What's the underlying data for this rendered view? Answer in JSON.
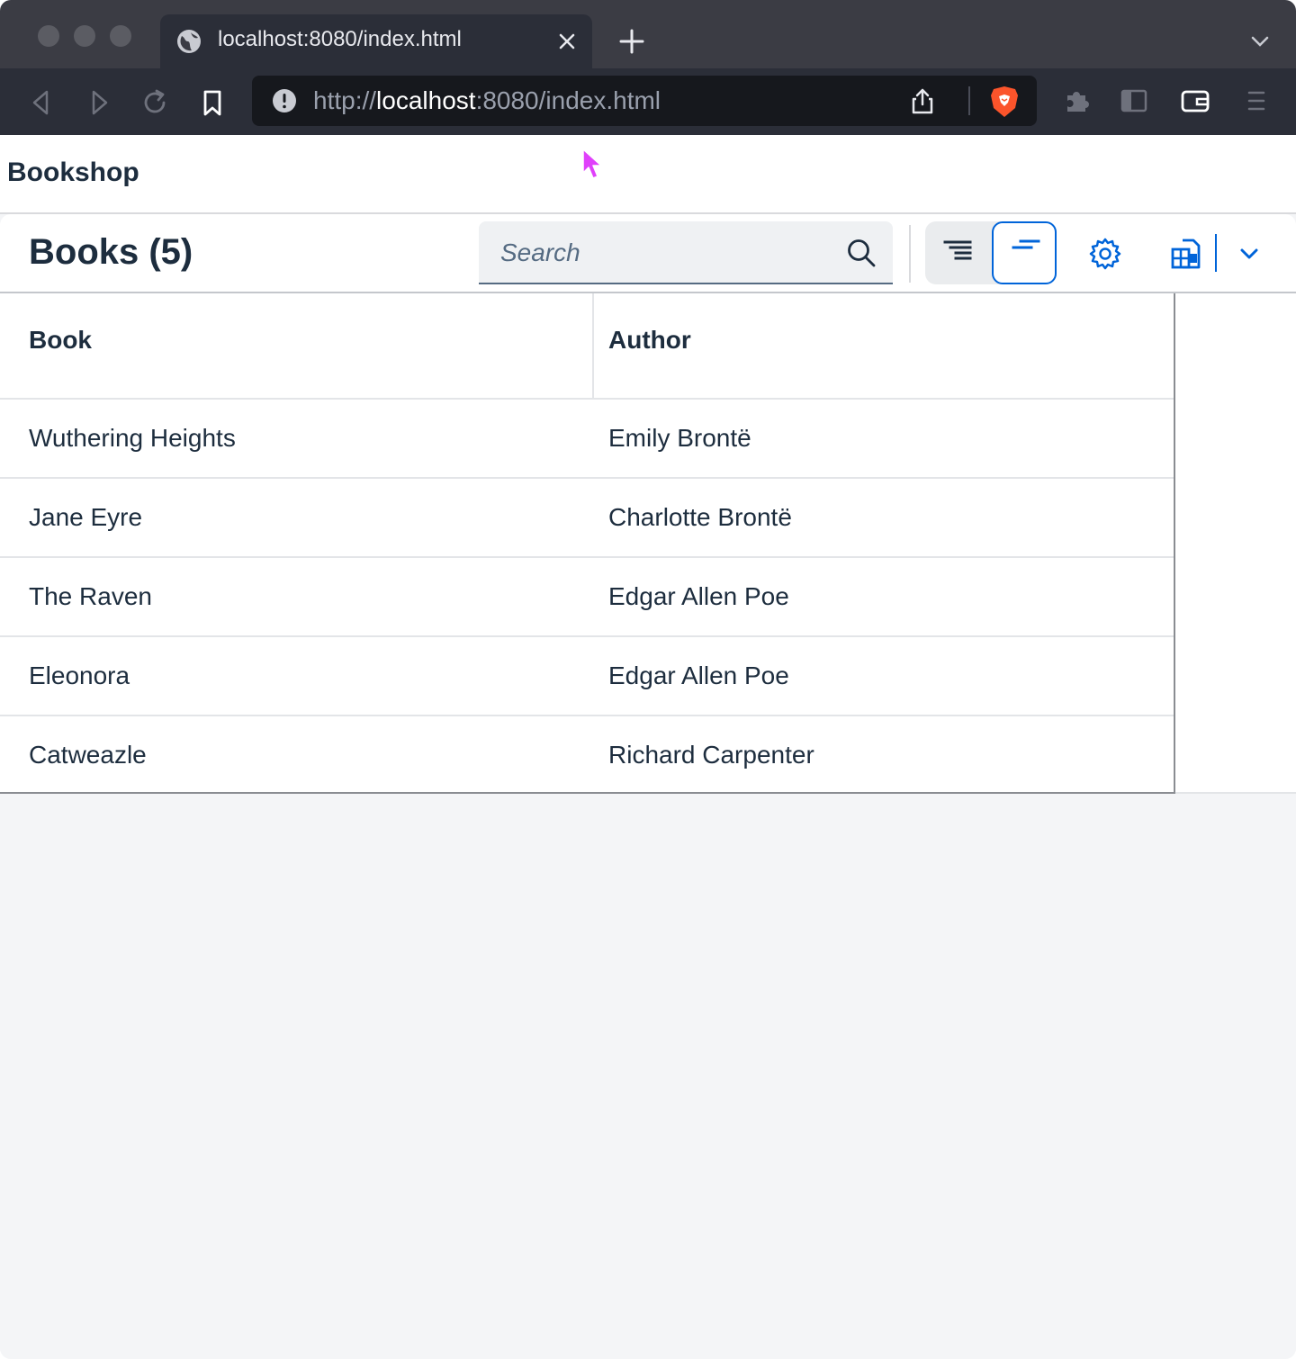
{
  "browser": {
    "tab_title": "localhost:8080/index.html",
    "url_scheme": "http://",
    "url_host": "localhost",
    "url_rest": ":8080/index.html",
    "icons": [
      "back-icon",
      "forward-icon",
      "reload-icon",
      "bookmark-icon",
      "site-info-icon",
      "share-icon",
      "brave-shields-icon",
      "extensions-icon",
      "sidebar-icon",
      "wallet-icon",
      "menu-icon"
    ]
  },
  "shell": {
    "title": "Bookshop"
  },
  "panel": {
    "title": "Books (5)",
    "search_placeholder": "Search",
    "accent_color": "#0064d9"
  },
  "table": {
    "columns": [
      "Book",
      "Author"
    ],
    "rows": [
      {
        "book": "Wuthering Heights",
        "author": "Emily Brontë"
      },
      {
        "book": "Jane Eyre",
        "author": "Charlotte Brontë"
      },
      {
        "book": "The Raven",
        "author": "Edgar Allen Poe"
      },
      {
        "book": "Eleonora",
        "author": "Edgar Allen Poe"
      },
      {
        "book": "Catweazle",
        "author": "Richard Carpenter"
      }
    ]
  }
}
